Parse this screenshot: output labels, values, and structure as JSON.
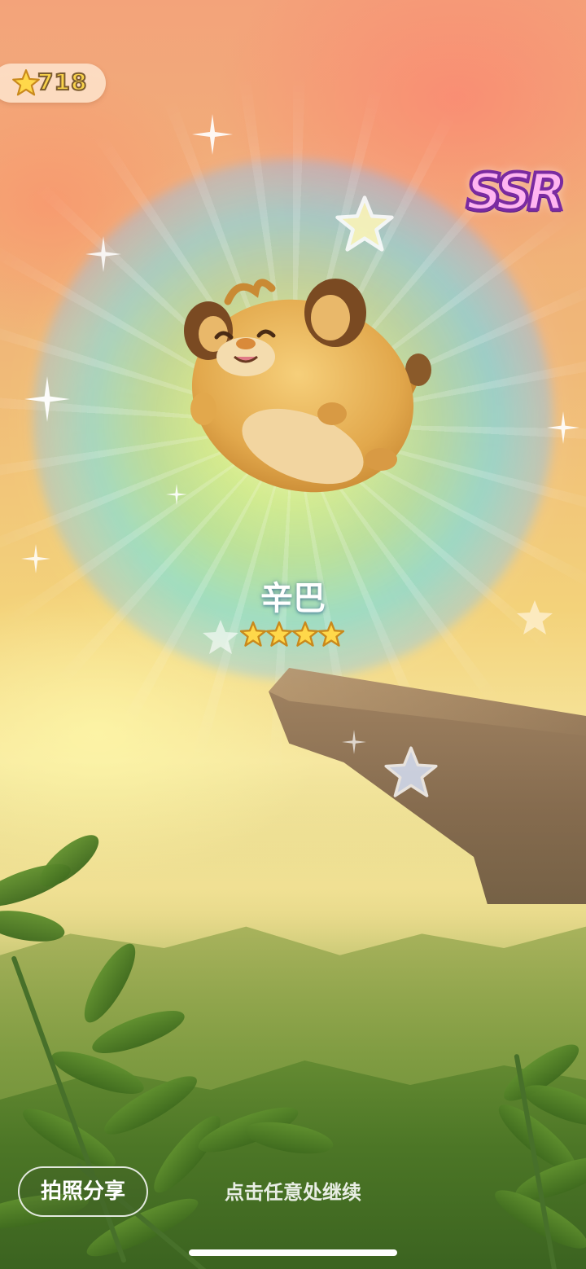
{
  "currency": {
    "icon": "star-icon",
    "value": "718"
  },
  "rarity": {
    "label": "SSR",
    "color": "#ffb5f1"
  },
  "character": {
    "name": "辛巴",
    "image": "lion-cub-plush-icon",
    "stars": 4
  },
  "actions": {
    "share_label": "拍照分享"
  },
  "hint": {
    "continue_text": "点击任意处继续"
  },
  "colors": {
    "star_fill": "#ffd84a",
    "star_outline": "#c9891c",
    "text_stroke": "#7b5b2f"
  }
}
